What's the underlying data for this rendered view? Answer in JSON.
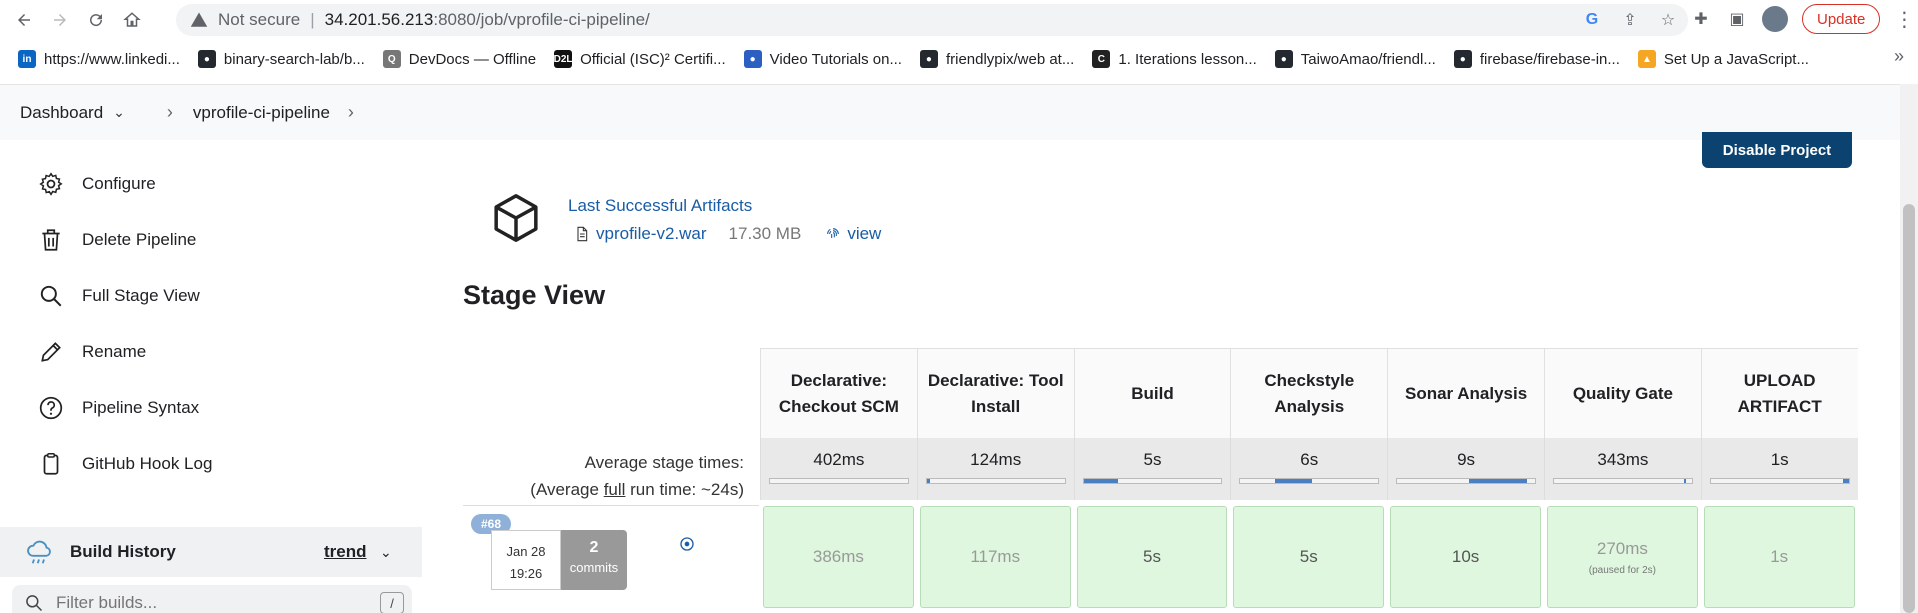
{
  "browser": {
    "not_secure": "Not secure",
    "host": "34.201.56.213",
    "path": ":8080/job/vprofile-ci-pipeline/",
    "update_label": "Update",
    "bookmarks": [
      {
        "label": "https://www.linkedi...",
        "icon": "linkedin-icon",
        "color": "#0a66c2",
        "glyph": "in"
      },
      {
        "label": "binary-search-lab/b...",
        "icon": "github-icon",
        "color": "#24292f",
        "glyph": ""
      },
      {
        "label": "DevDocs — Offline",
        "icon": "devdocs-icon",
        "color": "#777777",
        "glyph": "Q"
      },
      {
        "label": "Official (ISC)² Certifi...",
        "icon": "d2l-icon",
        "color": "#111111",
        "glyph": "D2L"
      },
      {
        "label": "Video Tutorials on...",
        "icon": "tutorial-icon",
        "color": "#2b5fc2",
        "glyph": "●"
      },
      {
        "label": "friendlypix/web at...",
        "icon": "github-icon",
        "color": "#24292f",
        "glyph": ""
      },
      {
        "label": "1. Iterations lesson...",
        "icon": "course-icon",
        "color": "#222222",
        "glyph": "C"
      },
      {
        "label": "TaiwoAmao/friendl...",
        "icon": "github-icon",
        "color": "#24292f",
        "glyph": ""
      },
      {
        "label": "firebase/firebase-in...",
        "icon": "github-icon",
        "color": "#24292f",
        "glyph": ""
      },
      {
        "label": "Set Up a JavaScript...",
        "icon": "firebase-icon",
        "color": "#f5a623",
        "glyph": "▲"
      }
    ]
  },
  "breadcrumb": {
    "dashboard": "Dashboard",
    "job": "vprofile-ci-pipeline"
  },
  "sidebar": {
    "items": [
      {
        "label": "Configure",
        "icon": "gear-icon"
      },
      {
        "label": "Delete Pipeline",
        "icon": "trash-icon"
      },
      {
        "label": "Full Stage View",
        "icon": "search-icon"
      },
      {
        "label": "Rename",
        "icon": "pencil-icon"
      },
      {
        "label": "Pipeline Syntax",
        "icon": "help-icon"
      },
      {
        "label": "GitHub Hook Log",
        "icon": "clipboard-icon"
      }
    ],
    "build_history": "Build History",
    "trend": "trend",
    "filter_placeholder": "Filter builds...",
    "filter_shortcut": "/"
  },
  "main": {
    "disable_label": "Disable Project",
    "artifacts_title": "Last Successful Artifacts",
    "artifact_file": "vprofile-v2.war",
    "artifact_size": "17.30 MB",
    "artifact_view": "view",
    "stage_view_title": "Stage View",
    "avg_line1": "Average stage times:",
    "avg_line2_pre": "(Average ",
    "avg_line2_u": "full",
    "avg_line2_post": " run time: ~24s)"
  },
  "stages": [
    {
      "name": "Declarative: Checkout SCM",
      "avg": "402ms",
      "run": "386ms",
      "fill_start": 0.0,
      "fill_width": 0.0
    },
    {
      "name": "Declarative: Tool Install",
      "avg": "124ms",
      "run": "117ms",
      "fill_start": 0.0,
      "fill_width": 0.02
    },
    {
      "name": "Build",
      "avg": "5s",
      "run": "5s",
      "fill_start": 0.0,
      "fill_width": 0.25
    },
    {
      "name": "Checkstyle Analysis",
      "avg": "6s",
      "run": "5s",
      "fill_start": 0.25,
      "fill_width": 0.27
    },
    {
      "name": "Sonar Analysis",
      "avg": "9s",
      "run": "10s",
      "fill_start": 0.52,
      "fill_width": 0.42
    },
    {
      "name": "Quality Gate",
      "avg": "343ms",
      "run": "270ms",
      "fill_start": 0.94,
      "fill_width": 0.02,
      "note": "(paused for 2s)"
    },
    {
      "name": "UPLOAD ARTIFACT",
      "avg": "1s",
      "run": "1s",
      "fill_start": 0.96,
      "fill_width": 0.04
    }
  ],
  "run": {
    "number": "#68",
    "date": "Jan 28",
    "time": "19:26",
    "commits_count": "2",
    "commits_label": "commits"
  }
}
